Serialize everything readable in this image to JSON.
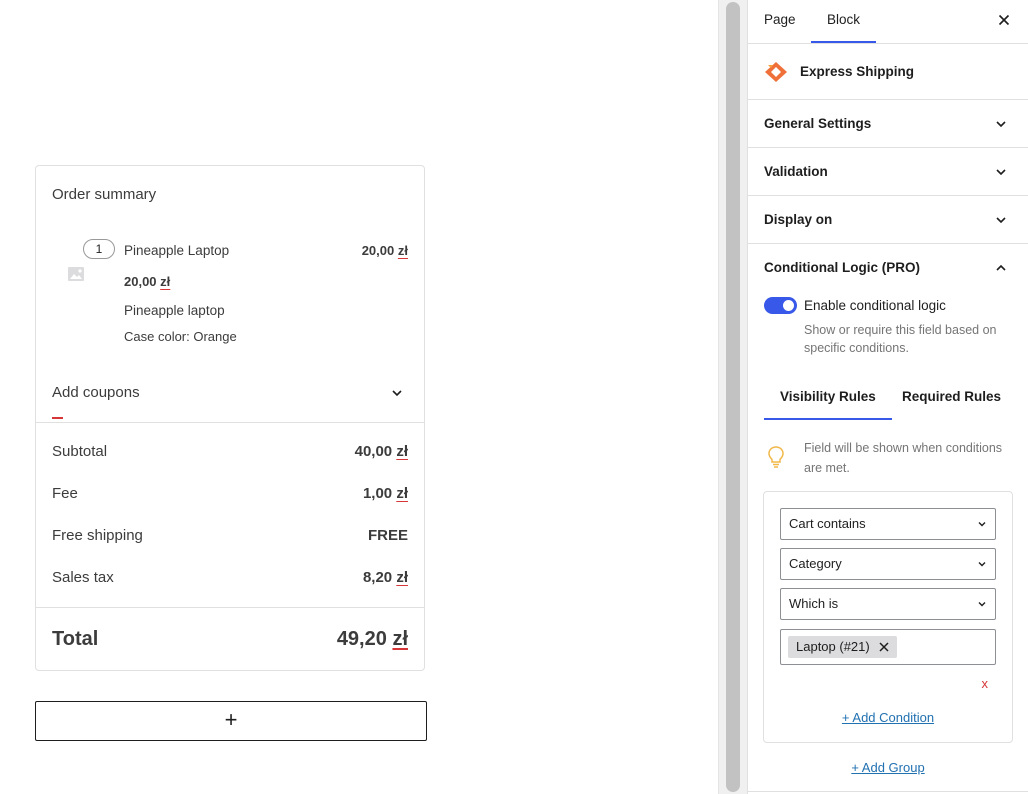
{
  "order_summary": {
    "title": "Order summary",
    "item": {
      "quantity": "1",
      "name": "Pineapple Laptop",
      "line_total": {
        "amount": "20,00",
        "currency": "zł"
      },
      "unit_price": {
        "amount": "20,00",
        "currency": "zł"
      },
      "description": "Pineapple laptop",
      "meta": "Case color: Orange"
    },
    "coupons_label": "Add coupons",
    "totals": [
      {
        "label": "Subtotal",
        "amount": "40,00",
        "currency": "zł"
      },
      {
        "label": "Fee",
        "amount": "1,00",
        "currency": "zł"
      },
      {
        "label": "Free shipping",
        "amount": "FREE",
        "currency": ""
      },
      {
        "label": "Sales tax",
        "amount": "8,20",
        "currency": "zł"
      }
    ],
    "total": {
      "label": "Total",
      "amount": "49,20",
      "currency": "zł"
    }
  },
  "add_block_label": "+",
  "sidebar": {
    "tabs": {
      "page": "Page",
      "block": "Block",
      "active": "Block"
    },
    "block": {
      "title": "Express Shipping",
      "icon": "express-shipping-icon",
      "icon_color": "#f0703a"
    },
    "panels": {
      "general": "General Settings",
      "validation": "Validation",
      "display_on": "Display on",
      "conditional": "Conditional Logic (PRO)"
    },
    "toggle": {
      "label": "Enable conditional logic",
      "enabled": true,
      "help": "Show or require this field based on specific conditions."
    },
    "rule_tabs": {
      "visibility": "Visibility Rules",
      "required": "Required Rules",
      "active": "Visibility Rules"
    },
    "hint": "Field will be shown when conditions are met.",
    "condition": {
      "type": "Cart contains",
      "field": "Category",
      "operator": "Which is",
      "tokens": [
        "Laptop (#21)"
      ],
      "remove_label": "x",
      "add_condition_label": "+ Add Condition"
    },
    "add_group_label": "+ Add Group"
  },
  "colors": {
    "accent": "#3858e9",
    "link": "#2271b1",
    "error": "#d63638",
    "bulb": "#f0b849"
  }
}
